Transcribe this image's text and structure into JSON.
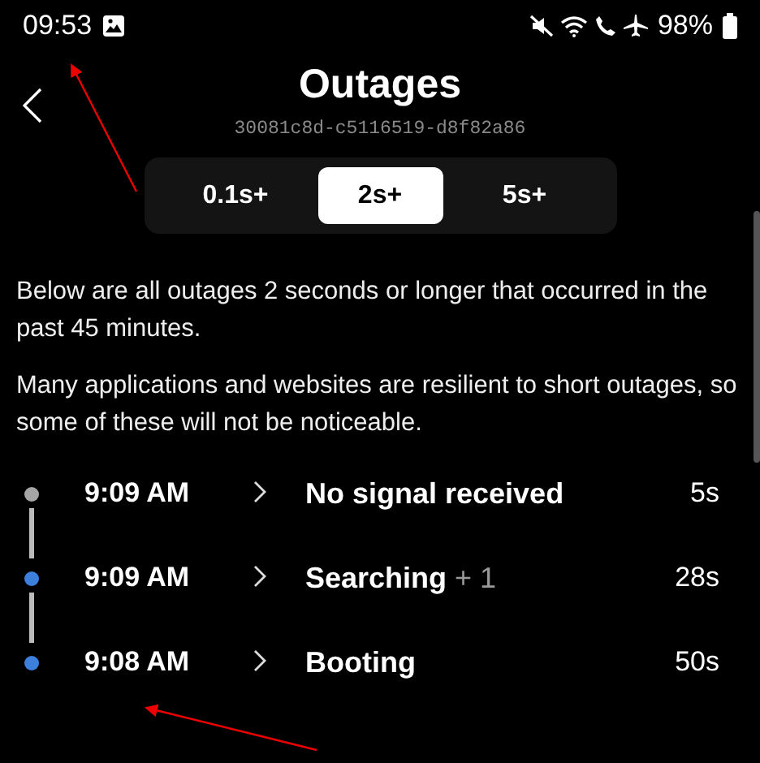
{
  "status_bar": {
    "time": "09:53",
    "battery": "98%"
  },
  "header": {
    "title": "Outages",
    "device_id": "30081c8d-c5116519-d8f82a86"
  },
  "filters": [
    {
      "label": "0.1s+",
      "selected": false
    },
    {
      "label": "2s+",
      "selected": true
    },
    {
      "label": "5s+",
      "selected": false
    }
  ],
  "paragraphs": [
    "Below are all outages 2 seconds or longer that occurred in the past 45 minutes.",
    "Many applications and websites are resilient to short outages, so some of these will not be noticeable."
  ],
  "outages": [
    {
      "time": "9:09 AM",
      "label": "No signal received",
      "duration": "5s",
      "color": "#a6a6a6"
    },
    {
      "time": "9:09 AM",
      "label": "Searching",
      "extra": "+ 1",
      "duration": "28s",
      "color": "#3d7fdc"
    },
    {
      "time": "9:08 AM",
      "label": "Booting",
      "duration": "50s",
      "color": "#3d7fdc"
    }
  ]
}
